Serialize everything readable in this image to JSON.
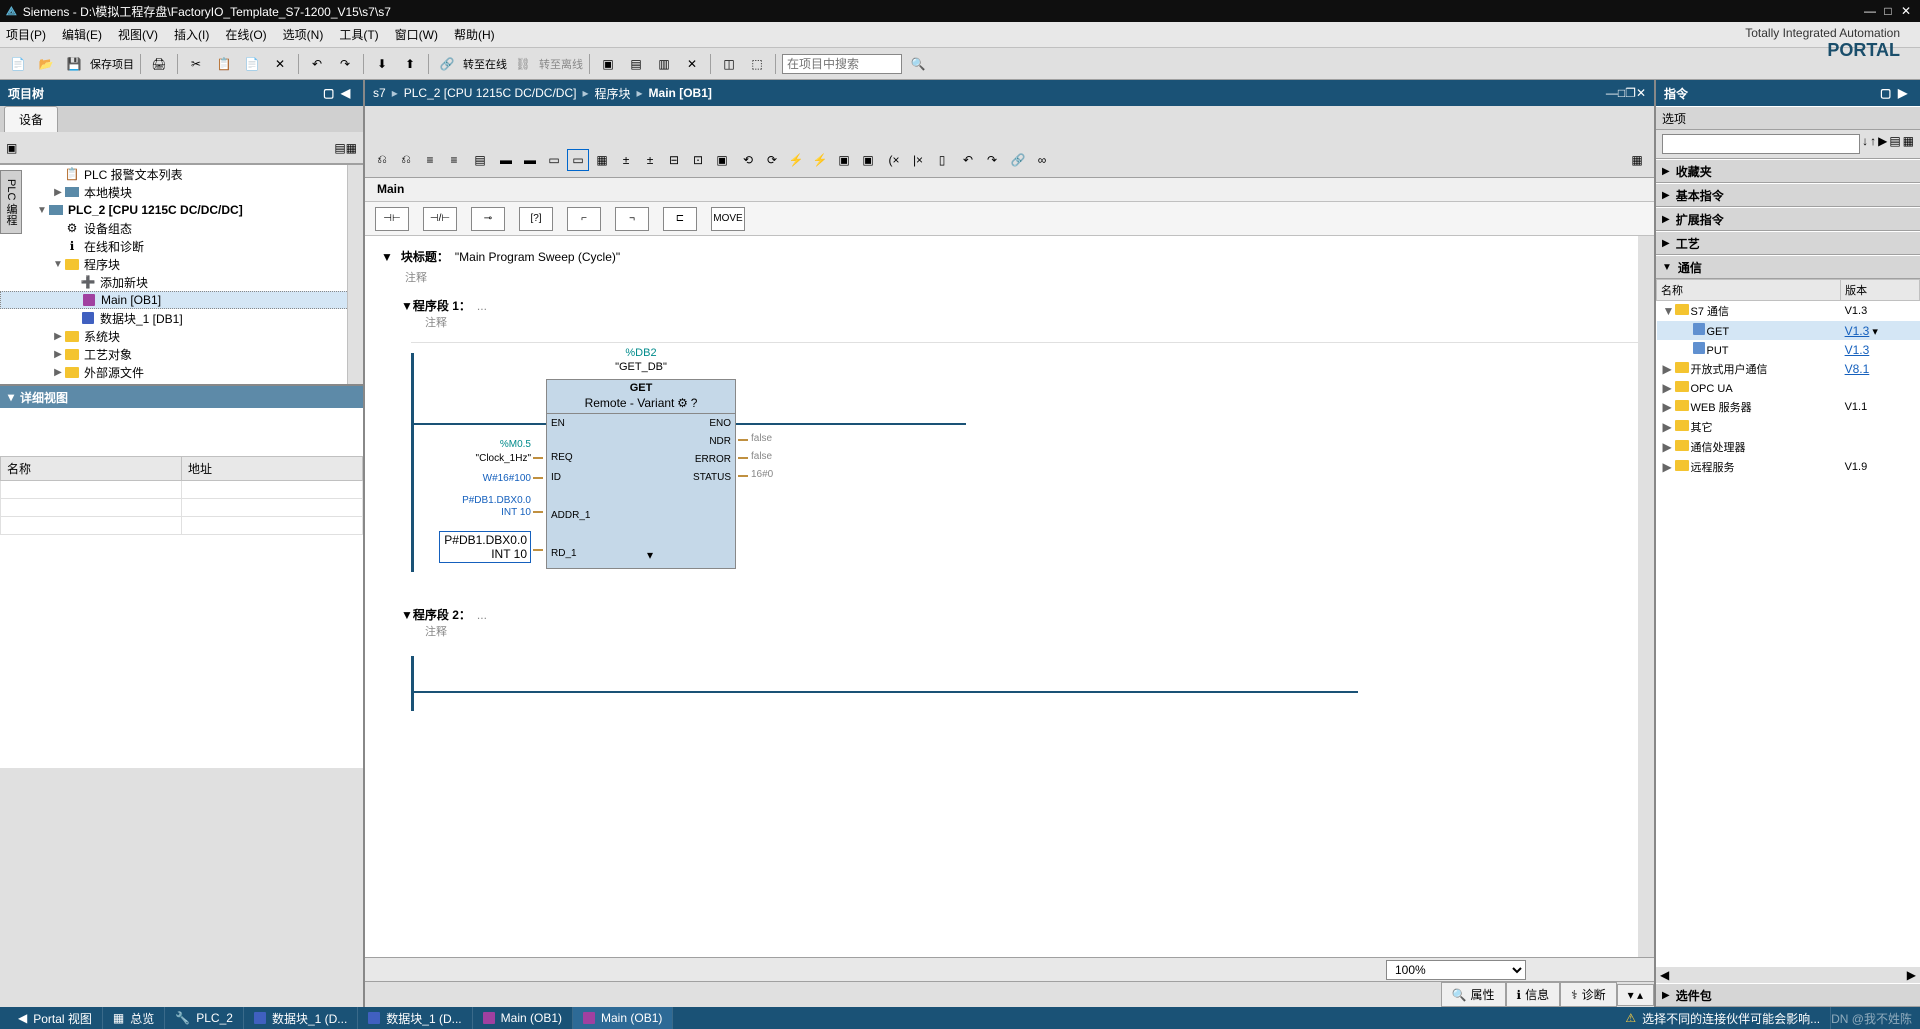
{
  "title": "Siemens  -  D:\\模拟工程存盘\\FactoryIO_Template_S7-1200_V15\\s7\\s7",
  "brand": {
    "line1": "Totally Integrated Automation",
    "line2": "PORTAL"
  },
  "menu": {
    "project": "项目(P)",
    "edit": "编辑(E)",
    "view": "视图(V)",
    "insert": "插入(I)",
    "online": "在线(O)",
    "options": "选项(N)",
    "tools": "工具(T)",
    "window": "窗口(W)",
    "help": "帮助(H)"
  },
  "toolbar": {
    "save": "保存项目",
    "goonline": "转至在线",
    "gooffline": "转至离线",
    "search_ph": "在项目中搜索"
  },
  "left": {
    "title": "项目树",
    "tab": "设备",
    "tree": {
      "alarm": "PLC 报警文本列表",
      "local": "本地模块",
      "plc2": "PLC_2 [CPU 1215C DC/DC/DC]",
      "devcfg": "设备组态",
      "diag": "在线和诊断",
      "prgblocks": "程序块",
      "addnew": "添加新块",
      "main": "Main [OB1]",
      "db1": "数据块_1 [DB1]",
      "sysblocks": "系统块",
      "tech": "工艺对象",
      "ext": "外部源文件"
    },
    "detail": {
      "title": "详细视图",
      "col_name": "名称",
      "col_addr": "地址"
    },
    "sidetab": "PLC 编程"
  },
  "center": {
    "bc": {
      "p1": "s7",
      "p2": "PLC_2 [CPU 1215C DC/DC/DC]",
      "p3": "程序块",
      "p4": "Main [OB1]"
    },
    "name": "Main",
    "blk_title_lbl": "块标题：",
    "blk_title_val": "\"Main Program Sweep (Cycle)\"",
    "comment": "注释",
    "net1": "程序段 1：",
    "net2": "程序段 2：",
    "ladder_btns": {
      "move": "MOVE"
    },
    "fb": {
      "db": "%DB2",
      "dbname": "\"GET_DB\"",
      "title": "GET",
      "sub": "Remote - Variant",
      "en": "EN",
      "eno": "ENO",
      "req": "REQ",
      "ndr": "NDR",
      "id": "ID",
      "error": "ERROR",
      "addr1": "ADDR_1",
      "status": "STATUS",
      "rd1": "RD_1",
      "clk_addr": "%M0.5",
      "clk_sym": "\"Clock_1Hz\"",
      "id_val": "W#16#100",
      "addr1_v1": "P#DB1.DBX0.0",
      "addr1_v2": "INT 10",
      "rd1_v1": "P#DB1.DBX0.0",
      "rd1_v2": "INT 10",
      "false": "false",
      "status_v": "16#0"
    },
    "zoom": "100%",
    "props": {
      "p": "属性",
      "i": "信息",
      "d": "诊断"
    }
  },
  "right": {
    "title": "指令",
    "options": "选项",
    "sections": {
      "fav": "收藏夹",
      "basic": "基本指令",
      "ext": "扩展指令",
      "tech": "工艺",
      "comm": "通信"
    },
    "cols": {
      "name": "名称",
      "ver": "版本"
    },
    "items": [
      {
        "name": "S7 通信",
        "ver": "V1.3",
        "lvl": 0,
        "exp": "▼",
        "ic": "folder"
      },
      {
        "name": "GET",
        "ver": "V1.3",
        "lvl": 1,
        "sel": true,
        "link": true,
        "ic": "block"
      },
      {
        "name": "PUT",
        "ver": "V1.3",
        "lvl": 1,
        "link": true,
        "ic": "block"
      },
      {
        "name": "开放式用户通信",
        "ver": "V8.1",
        "lvl": 0,
        "exp": "▶",
        "link": true,
        "ic": "folder"
      },
      {
        "name": "OPC UA",
        "ver": "",
        "lvl": 0,
        "exp": "▶",
        "ic": "folder"
      },
      {
        "name": "WEB 服务器",
        "ver": "V1.1",
        "lvl": 0,
        "exp": "▶",
        "ic": "folder"
      },
      {
        "name": "其它",
        "ver": "",
        "lvl": 0,
        "exp": "▶",
        "ic": "folder"
      },
      {
        "name": "通信处理器",
        "ver": "",
        "lvl": 0,
        "exp": "▶",
        "ic": "folder"
      },
      {
        "name": "远程服务",
        "ver": "V1.9",
        "lvl": 0,
        "exp": "▶",
        "ic": "folder"
      }
    ],
    "cardpack": "选件包"
  },
  "status": {
    "portal": "Portal 视图",
    "overview": "总览",
    "plc2": "PLC_2",
    "db1a": "数据块_1 (D...",
    "db1b": "数据块_1 (D...",
    "main1": "Main (OB1)",
    "main2": "Main (OB1)",
    "warn": "选择不同的连接伙伴可能会影响...",
    "water": "DN @我不姓陈"
  }
}
